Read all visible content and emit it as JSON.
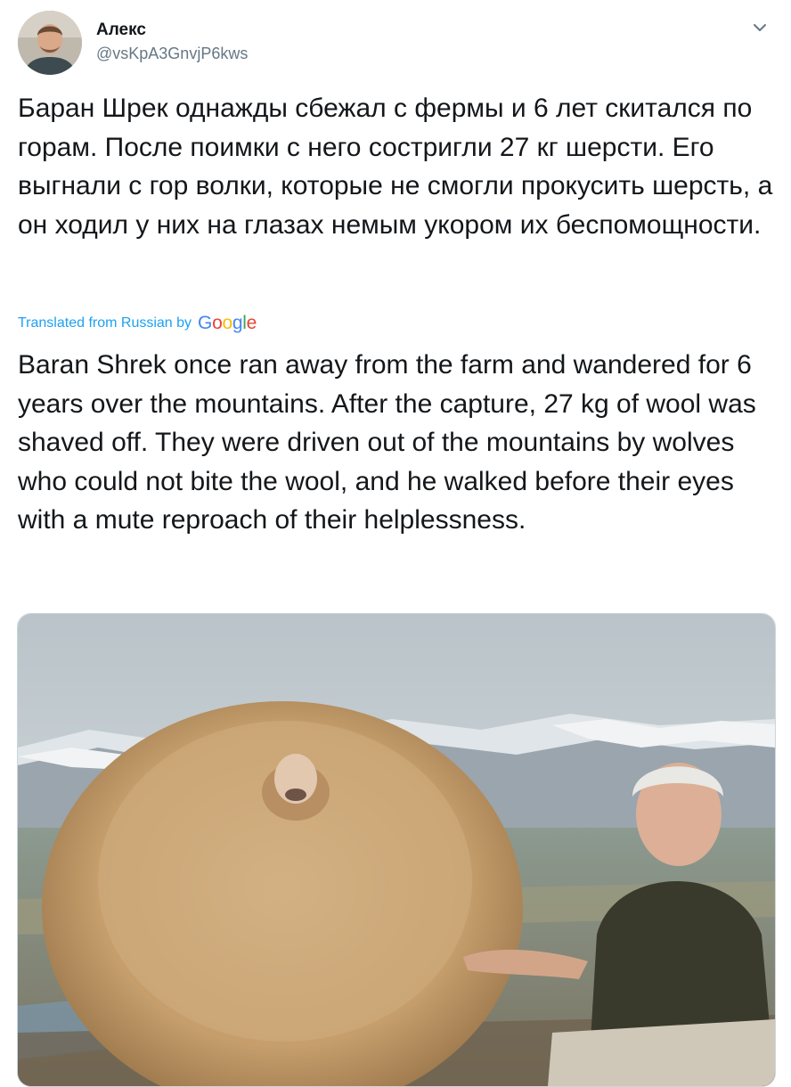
{
  "tweet": {
    "author": {
      "display_name": "Алекс",
      "handle": "@vsKpA3GnvjP6kws"
    },
    "text": "Баран Шрек однажды сбежал с фермы и 6 лет скитался по горам. После поимки с него состригли 27 кг шерсти. Его выгнали с гор волки, которые не смогли прокусить шерсть, а он ходил у них на глазах немым укором их беспомощности.",
    "translation": {
      "label": "Translated from Russian by",
      "provider": {
        "letters": [
          "G",
          "o",
          "o",
          "g",
          "l",
          "e"
        ],
        "colors": [
          "#4285f4",
          "#ea4335",
          "#fbbc05",
          "#4285f4",
          "#34a853",
          "#ea4335"
        ]
      },
      "text": "Baran Shrek once ran away from the farm and wandered for 6 years over the mountains. After the capture, 27 kg of wool was shaved off. They were driven out of the mountains by wolves who could not bite the wool, and he walked before their eyes with a mute reproach of their helplessness."
    },
    "icons": {
      "menu": "chevron-down-icon",
      "avatar": "avatar-photo"
    },
    "colors": {
      "text": "#14171a",
      "secondary": "#657786",
      "link": "#1da1f2",
      "border": "#ccd6dd"
    }
  }
}
